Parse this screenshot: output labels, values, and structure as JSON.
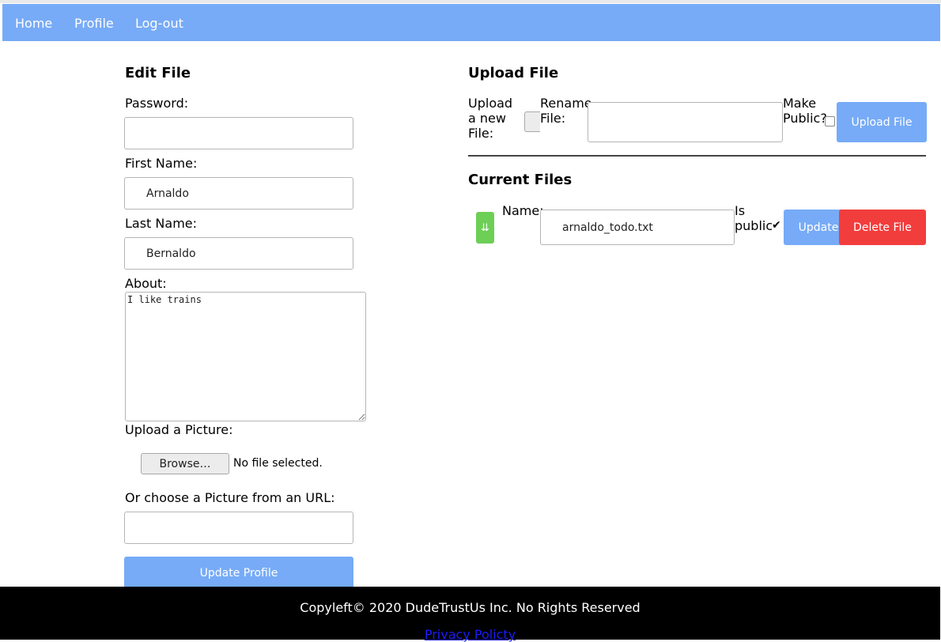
{
  "nav": {
    "home": "Home",
    "profile": "Profile",
    "logout": "Log-out"
  },
  "edit": {
    "title": "Edit File",
    "password_label": "Password:",
    "password_value": "",
    "first_label": "First Name:",
    "first_value": "Arnaldo",
    "last_label": "Last Name:",
    "last_value": "Bernaldo",
    "about_label": "About:",
    "about_value": "I like trains",
    "picture_label": "Upload a Picture:",
    "browse_label": "Browse…",
    "no_file": "No file selected.",
    "url_label": "Or choose a Picture from an URL:",
    "url_value": "",
    "update_profile": "Update Profile"
  },
  "upload": {
    "title": "Upload File",
    "new_file_label": "Upload a new File:",
    "rename_label": "Rename File:",
    "rename_value": "",
    "public_label": "Make Public?",
    "public_checked": false,
    "upload_button": "Upload File"
  },
  "current": {
    "title": "Current Files",
    "download_icon": "⇊",
    "name_label": "Name:",
    "name_value": "arnaldo_todo.txt",
    "public_label": "Is public:",
    "public_checked": true,
    "update_button": "Update",
    "delete_button": "Delete File"
  },
  "footer": {
    "copyright": "Copyleft© 2020 DudeTrustUs Inc. No Rights Reserved",
    "privacy": "Privacy Policty"
  },
  "colors": {
    "nav": "#77abf7",
    "primary_button": "#77abf7",
    "danger_button": "#f23d3d",
    "download_button": "#6dcf55",
    "footer": "#000000"
  }
}
